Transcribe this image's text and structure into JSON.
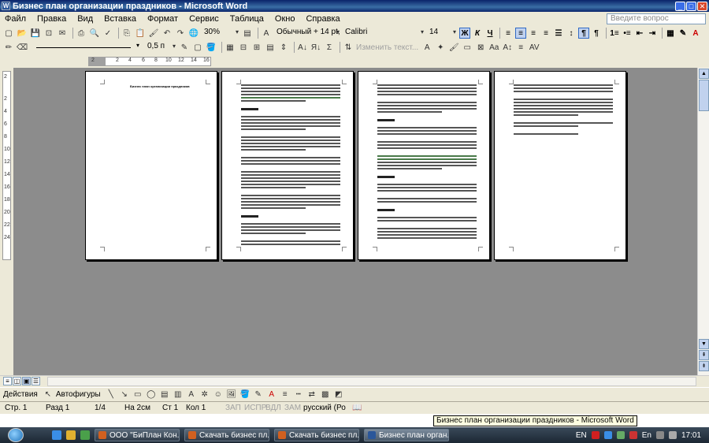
{
  "window": {
    "title": "Бизнес план организации праздников - Microsoft Word"
  },
  "menu": {
    "items": [
      "Файл",
      "Правка",
      "Вид",
      "Вставка",
      "Формат",
      "Сервис",
      "Таблица",
      "Окно",
      "Справка"
    ],
    "ask_placeholder": "Введите вопрос"
  },
  "toolbar": {
    "zoom": "30%",
    "style": "Обычный + 14 pt,",
    "font": "Calibri",
    "size": "14",
    "bold": "Ж",
    "italic": "К",
    "underline": "Ч",
    "line_weight": "0,5 п",
    "change_text": "Изменить текст..."
  },
  "ruler": {
    "ticks": [
      "2",
      "2",
      "4",
      "6",
      "8",
      "10",
      "12",
      "14",
      "16"
    ]
  },
  "vruler": {
    "ticks": [
      "2",
      "2",
      "4",
      "6",
      "8",
      "10",
      "12",
      "14",
      "16",
      "18",
      "20",
      "22",
      "24"
    ]
  },
  "pages": [
    {
      "heading": "Бизнес план организации праздников"
    }
  ],
  "drawbar": {
    "actions": "Действия",
    "autoshapes": "Автофигуры"
  },
  "status": {
    "page": "Стр. 1",
    "section": "Разд 1",
    "pages": "1/4",
    "at": "На 2см",
    "line": "Ст 1",
    "col": "Кол 1",
    "rec": "ЗАП",
    "trk": "ИСПР",
    "ext": "ВДЛ",
    "ovr": "ЗАМ",
    "lang": "русский (Ро"
  },
  "tooltip": "Бизнес план организации праздников - Microsoft Word",
  "taskbar": {
    "buttons": [
      {
        "label": "ООО \"БиПлан Кон..."
      },
      {
        "label": "Скачать бизнес пл..."
      },
      {
        "label": "Скачать бизнес пл..."
      },
      {
        "label": "Бизнес план орган..."
      }
    ],
    "lang": "EN",
    "lang2": "En",
    "time": "17:01"
  }
}
